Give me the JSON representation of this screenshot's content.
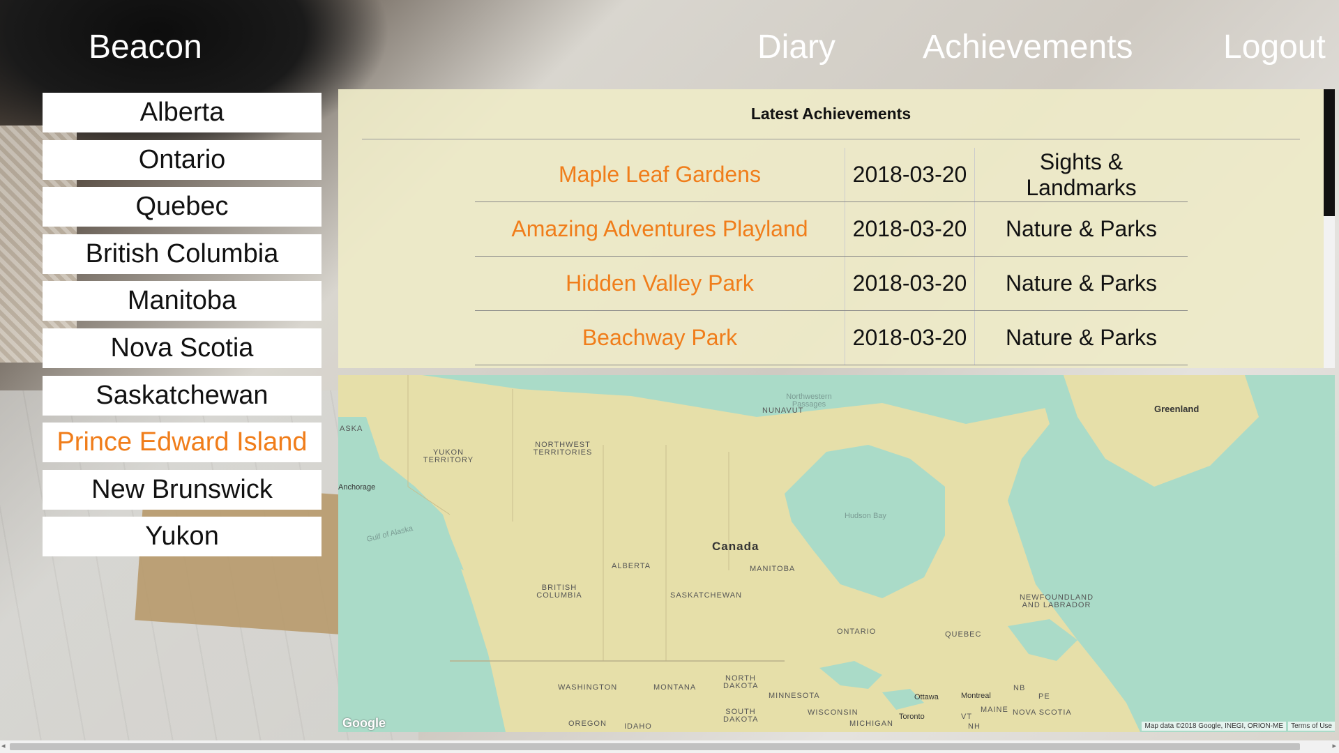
{
  "header": {
    "brand": "Beacon",
    "nav": [
      {
        "label": "Diary"
      },
      {
        "label": "Achievements"
      },
      {
        "label": "Logout"
      }
    ]
  },
  "provinces": {
    "active": "Prince Edward Island",
    "items": [
      {
        "label": "Alberta"
      },
      {
        "label": "Ontario"
      },
      {
        "label": "Quebec"
      },
      {
        "label": "British Columbia"
      },
      {
        "label": "Manitoba"
      },
      {
        "label": "Nova Scotia"
      },
      {
        "label": "Saskatchewan"
      },
      {
        "label": "Prince Edward Island"
      },
      {
        "label": "New Brunswick"
      },
      {
        "label": "Yukon"
      }
    ]
  },
  "achievements": {
    "title": "Latest Achievements",
    "rows": [
      {
        "name": "Maple Leaf Gardens",
        "date": "2018-03-20",
        "category": "Sights & Landmarks"
      },
      {
        "name": "Amazing Adventures Playland",
        "date": "2018-03-20",
        "category": "Nature & Parks"
      },
      {
        "name": "Hidden Valley Park",
        "date": "2018-03-20",
        "category": "Nature & Parks"
      },
      {
        "name": "Beachway Park",
        "date": "2018-03-20",
        "category": "Nature & Parks"
      }
    ]
  },
  "map": {
    "labels": {
      "nunavut": "NUNAVUT",
      "nw_passages": "Northwestern Passages",
      "greenland": "Greenland",
      "alaska": "ASKA",
      "yukon": "YUKON TERRITORY",
      "nwt": "NORTHWEST TERRITORIES",
      "anchorage": "Anchorage",
      "gulf_alaska": "Gulf of Alaska",
      "hudson_bay": "Hudson Bay",
      "canada": "Canada",
      "alberta": "ALBERTA",
      "manitoba": "MANITOBA",
      "bc": "BRITISH COLUMBIA",
      "saskatchewan": "SASKATCHEWAN",
      "newfoundland": "NEWFOUNDLAND AND LABRADOR",
      "ontario": "ONTARIO",
      "quebec": "QUEBEC",
      "washington": "WASHINGTON",
      "montana": "MONTANA",
      "north_dakota": "NORTH DAKOTA",
      "minnesota": "MINNESOTA",
      "ottawa": "Ottawa",
      "montreal": "Montreal",
      "nb": "NB",
      "pe": "PE",
      "south_dakota": "SOUTH DAKOTA",
      "wisconsin": "WISCONSIN",
      "toronto": "Toronto",
      "vt": "VT",
      "maine": "MAINE",
      "nova_scotia": "NOVA SCOTIA",
      "oregon": "OREGON",
      "idaho": "IDAHO",
      "michigan": "MICHIGAN",
      "nh": "NH"
    },
    "google": "Google",
    "attribution": "Map data ©2018 Google, INEGI, ORION-ME",
    "terms": "Terms of Use",
    "colors": {
      "land": "#e6dfa9",
      "water": "#aadbc8"
    }
  },
  "scrollbar": {
    "left_arrow": "◂",
    "right_arrow": "▸"
  }
}
